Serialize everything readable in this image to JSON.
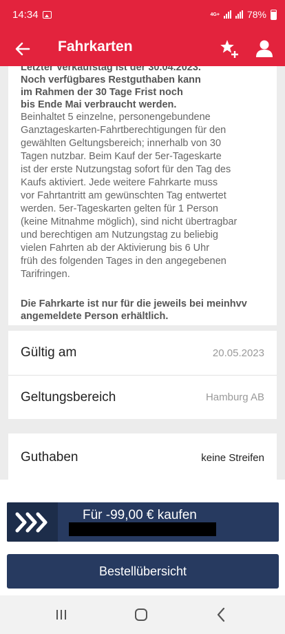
{
  "status_bar": {
    "time": "14:34",
    "network": "4G+",
    "battery": "78%"
  },
  "app_bar": {
    "title": "Fahrkarten"
  },
  "description": {
    "bold_top": "Letzter Verkaufstag ist der 30.04.2023.\nNoch verfügbares Restguthaben kann\nim Rahmen der 30 Tage Frist noch\nbis Ende Mai verbraucht werden.",
    "text": "Beinhaltet 5 einzelne, personengebundene\nGanztageskarten-Fahrtberechtigungen für den\ngewählten Geltungsbereich; innerhalb von 30\nTagen nutzbar. Beim Kauf der 5er-Tageskarte\nist der erste Nutzungstag sofort für den Tag des\nKaufs aktiviert. Jede weitere Fahrkarte muss\nvor Fahrtantritt am gewünschten Tag entwertet\nwerden.    5er-Tageskarten gelten für 1 Person\n(keine Mitnahme möglich), sind nicht übertragbar\nund berechtigen am Nutzungstag zu beliebig\nvielen Fahrten ab der Aktivierung bis 6 Uhr\nfrüh des folgenden Tages in den angegebenen\nTarifringen.",
    "bold_bottom": "Die Fahrkarte ist nur für die jeweils bei meinhvv\nangemeldete Person erhältlich."
  },
  "details": {
    "valid_label": "Gültig am",
    "valid_value": "20.05.2023",
    "area_label": "Geltungsbereich",
    "area_value": "Hamburg AB"
  },
  "credit": {
    "label": "Guthaben",
    "value": "keine Streifen"
  },
  "buy_button": {
    "label": "Für -99,00 € kaufen"
  },
  "order_button": {
    "label": "Bestellübersicht"
  },
  "icons": {
    "back": "arrow-left-icon",
    "favorite": "star-add-icon",
    "profile": "person-icon",
    "buy": "triple-chevron-right-icon"
  },
  "colors": {
    "brand_red": "#e3233d",
    "button_navy": "#273a60"
  }
}
